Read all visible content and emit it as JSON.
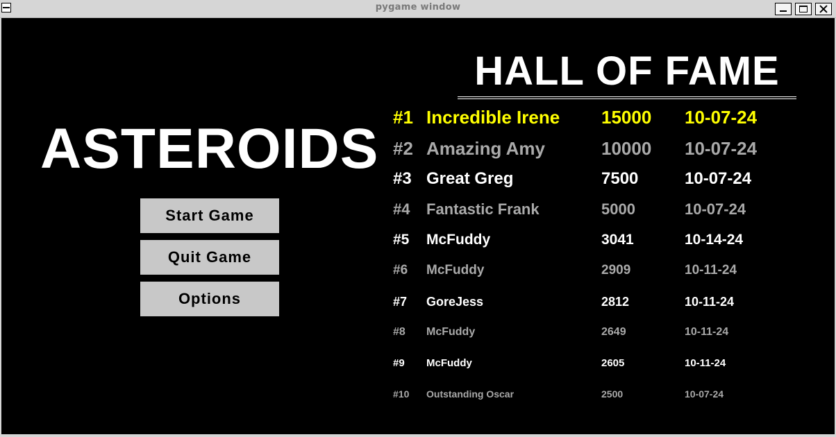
{
  "window": {
    "title": "pygame window",
    "controls": [
      "minimize",
      "maximize",
      "close"
    ]
  },
  "game": {
    "title": "ASTEROIDS",
    "buttons": {
      "start": "Start Game",
      "quit": "Quit Game",
      "options": "Options"
    }
  },
  "hall_of_fame": {
    "title": "HALL OF FAME",
    "entries": [
      {
        "rank": "#1",
        "name": "Incredible Irene",
        "score": "15000",
        "date": "10-07-24",
        "color": "#ffff00"
      },
      {
        "rank": "#2",
        "name": "Amazing Amy",
        "score": "10000",
        "date": "10-07-24",
        "color": "#aaaaaa"
      },
      {
        "rank": "#3",
        "name": "Great Greg",
        "score": "7500",
        "date": "10-07-24",
        "color": "#ffffff"
      },
      {
        "rank": "#4",
        "name": "Fantastic Frank",
        "score": "5000",
        "date": "10-07-24",
        "color": "#aaaaaa"
      },
      {
        "rank": "#5",
        "name": "McFuddy",
        "score": "3041",
        "date": "10-14-24",
        "color": "#ffffff"
      },
      {
        "rank": "#6",
        "name": "McFuddy",
        "score": "2909",
        "date": "10-11-24",
        "color": "#aaaaaa"
      },
      {
        "rank": "#7",
        "name": "GoreJess",
        "score": "2812",
        "date": "10-11-24",
        "color": "#ffffff"
      },
      {
        "rank": "#8",
        "name": "McFuddy",
        "score": "2649",
        "date": "10-11-24",
        "color": "#aaaaaa"
      },
      {
        "rank": "#9",
        "name": "McFuddy",
        "score": "2605",
        "date": "10-11-24",
        "color": "#ffffff"
      },
      {
        "rank": "#10",
        "name": "Outstanding Oscar",
        "score": "2500",
        "date": "10-07-24",
        "color": "#aaaaaa"
      }
    ]
  }
}
